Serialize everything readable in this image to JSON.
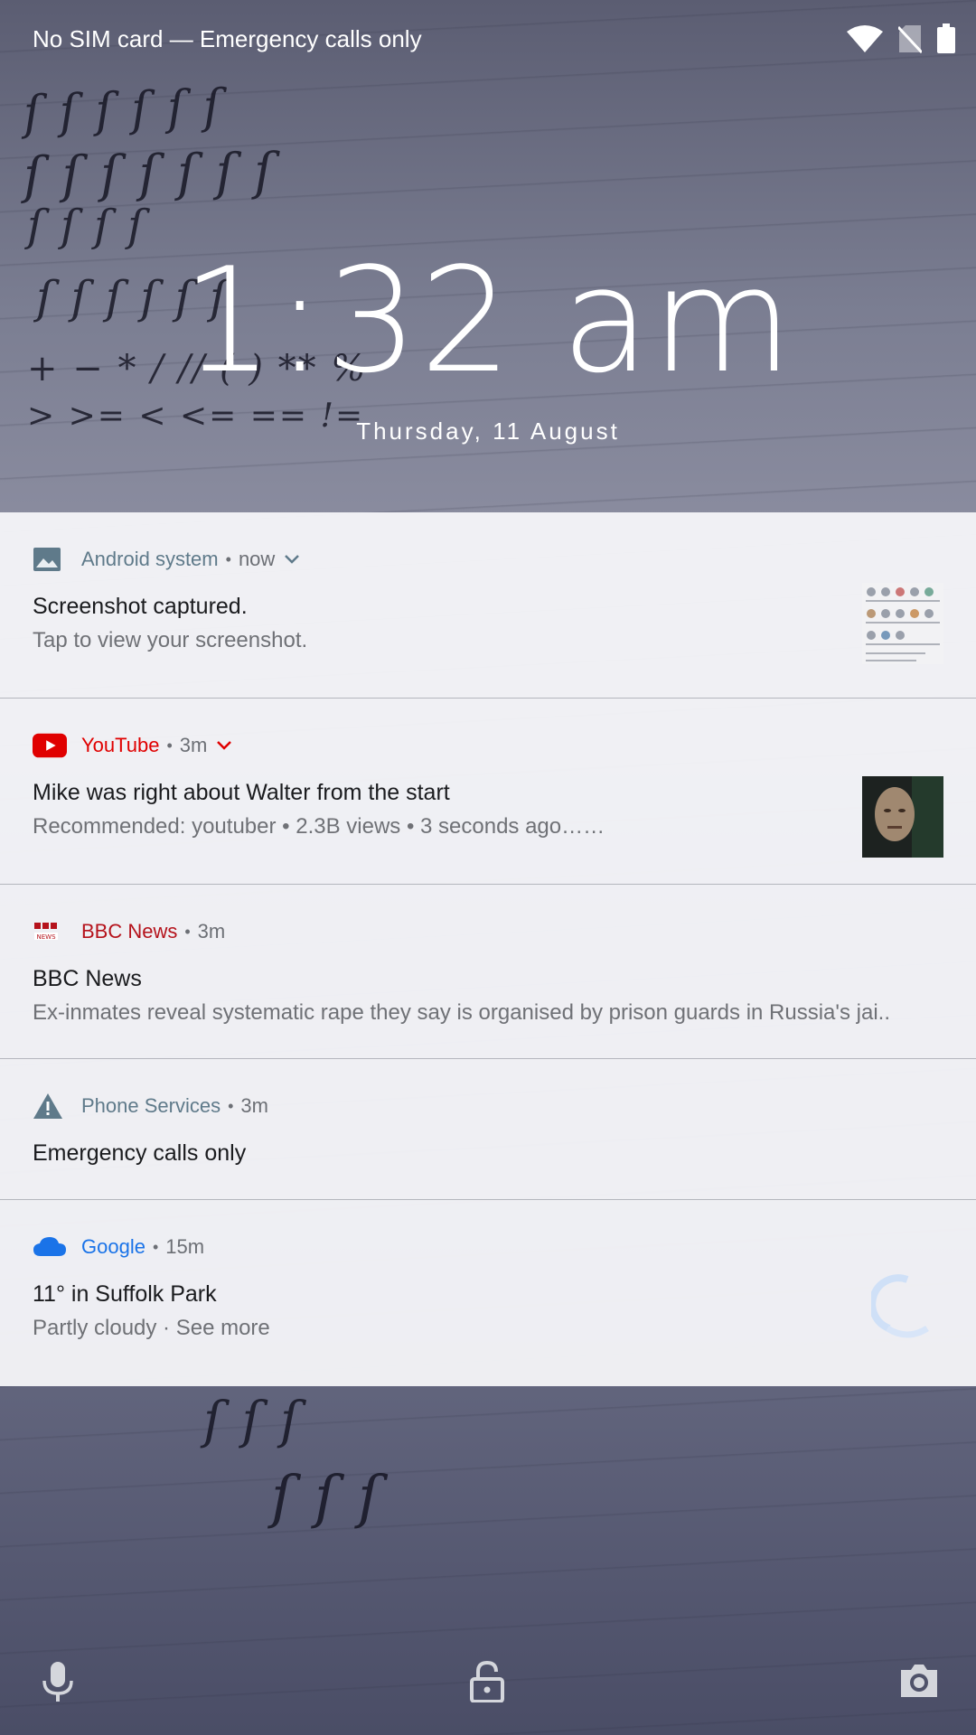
{
  "status_bar": {
    "carrier_text": "No SIM card — Emergency calls only",
    "icons": [
      "wifi-icon",
      "no-sim-icon",
      "battery-icon"
    ]
  },
  "lockscreen": {
    "time": "1:32 am",
    "date": "Thursday, 11 August"
  },
  "notifications": [
    {
      "app": "Android system",
      "time": "now",
      "icon": "image-icon",
      "expandable": true,
      "title": "Screenshot captured.",
      "body": "Tap to view your screenshot.",
      "accent": "#5f7a8a",
      "has_thumbnail": true
    },
    {
      "app": "YouTube",
      "time": "3m",
      "icon": "youtube-icon",
      "expandable": true,
      "title": "Mike was right about Walter from the start",
      "body": "Recommended: youtuber • 2.3B views • 3 seconds ago……",
      "accent": "#e00000",
      "has_thumbnail": true
    },
    {
      "app": "BBC News",
      "time": "3m",
      "icon": "bbc-news-icon",
      "expandable": false,
      "title": "BBC News",
      "body": "Ex-inmates reveal systematic rape they say is organised by prison guards in Russia's jai..",
      "accent": "#b5121b",
      "has_thumbnail": false
    },
    {
      "app": "Phone Services",
      "time": "3m",
      "icon": "warning-icon",
      "expandable": false,
      "title": "Emergency calls only",
      "body": "",
      "accent": "#5f7a8a",
      "has_thumbnail": false
    },
    {
      "app": "Google",
      "time": "15m",
      "icon": "cloud-icon",
      "expandable": false,
      "title": "11° in Suffolk Park",
      "body": "Partly cloudy · See more",
      "accent": "#1a73e8",
      "has_thumbnail": true
    }
  ],
  "bottom_bar": {
    "icons": [
      "microphone-icon",
      "lock-icon",
      "camera-icon"
    ]
  }
}
